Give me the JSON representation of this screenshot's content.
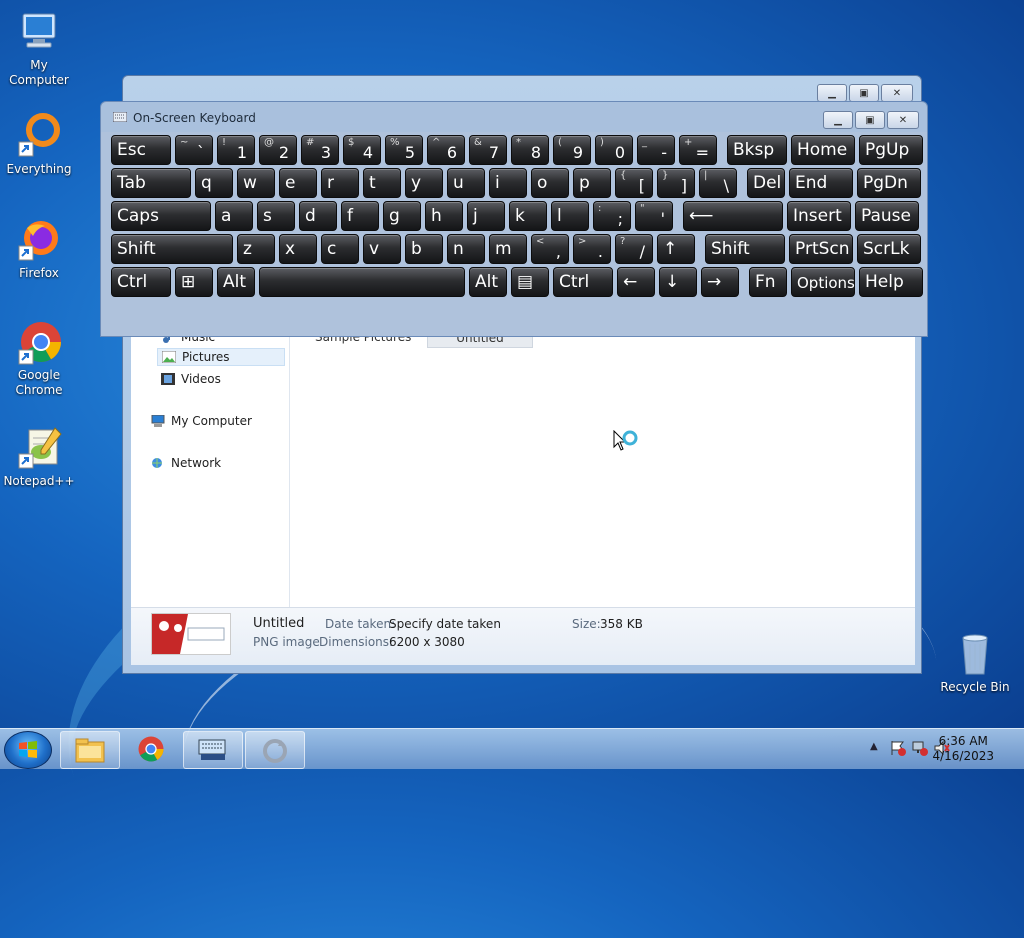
{
  "desktop": {
    "icons": [
      {
        "label": "My Computer"
      },
      {
        "label": "Everything"
      },
      {
        "label": "Firefox"
      },
      {
        "label": "Google Chrome"
      },
      {
        "label": "Notepad++"
      },
      {
        "label": "Recycle Bin"
      }
    ]
  },
  "explorer": {
    "nav": {
      "music": "Music",
      "pictures": "Pictures",
      "videos": "Videos",
      "my_computer": "My Computer",
      "network": "Network"
    },
    "columns": {
      "folder": "Sample Pictures",
      "file": "Untitled"
    },
    "details": {
      "name": "Untitled",
      "type": "PNG image",
      "date_label": "Date taken:",
      "date_value": "Specify date taken",
      "dim_label": "Dimensions:",
      "dim_value": "6200 x 3080",
      "size_label": "Size:",
      "size_value": "358 KB"
    }
  },
  "osk": {
    "title": "On-Screen Keyboard",
    "rows": [
      [
        {
          "m": "Esc",
          "w": 60
        },
        {
          "s": "~",
          "l": "`",
          "w": 38
        },
        {
          "s": "!",
          "l": "1",
          "w": 38
        },
        {
          "s": "@",
          "l": "2",
          "w": 38
        },
        {
          "s": "#",
          "l": "3",
          "w": 38
        },
        {
          "s": "$",
          "l": "4",
          "w": 38
        },
        {
          "s": "%",
          "l": "5",
          "w": 38
        },
        {
          "s": "^",
          "l": "6",
          "w": 38
        },
        {
          "s": "&",
          "l": "7",
          "w": 38
        },
        {
          "s": "*",
          "l": "8",
          "w": 38
        },
        {
          "s": "(",
          "l": "9",
          "w": 38
        },
        {
          "s": ")",
          "l": "0",
          "w": 38
        },
        {
          "s": "_",
          "l": "-",
          "w": 38
        },
        {
          "s": "+",
          "l": "=",
          "w": 38
        },
        {
          "m": "Bksp",
          "w": 60,
          "gap": 6
        },
        {
          "m": "Home",
          "w": 64
        },
        {
          "m": "PgUp",
          "w": 64
        }
      ],
      [
        {
          "m": "Tab",
          "w": 80
        },
        {
          "m": "q",
          "w": 38
        },
        {
          "m": "w",
          "w": 38
        },
        {
          "m": "e",
          "w": 38
        },
        {
          "m": "r",
          "w": 38
        },
        {
          "m": "t",
          "w": 38
        },
        {
          "m": "y",
          "w": 38
        },
        {
          "m": "u",
          "w": 38
        },
        {
          "m": "i",
          "w": 38
        },
        {
          "m": "o",
          "w": 38
        },
        {
          "m": "p",
          "w": 38
        },
        {
          "s": "{",
          "l": "[",
          "w": 38
        },
        {
          "s": "}",
          "l": "]",
          "w": 38
        },
        {
          "s": "|",
          "l": "\\",
          "w": 38
        },
        {
          "m": "Del",
          "w": 38,
          "gap": 6
        },
        {
          "m": "End",
          "w": 64
        },
        {
          "m": "PgDn",
          "w": 64
        }
      ],
      [
        {
          "m": "Caps",
          "w": 100
        },
        {
          "m": "a",
          "w": 38
        },
        {
          "m": "s",
          "w": 38
        },
        {
          "m": "d",
          "w": 38
        },
        {
          "m": "f",
          "w": 38
        },
        {
          "m": "g",
          "w": 38
        },
        {
          "m": "h",
          "w": 38
        },
        {
          "m": "j",
          "w": 38
        },
        {
          "m": "k",
          "w": 38
        },
        {
          "m": "l",
          "w": 38
        },
        {
          "s": ":",
          "l": ";",
          "w": 38
        },
        {
          "s": "\"",
          "l": "'",
          "w": 38
        },
        {
          "m": "⟵",
          "w": 100,
          "gap": 6
        },
        {
          "m": "Insert",
          "w": 64
        },
        {
          "m": "Pause",
          "w": 64
        }
      ],
      [
        {
          "m": "Shift",
          "w": 122
        },
        {
          "m": "z",
          "w": 38
        },
        {
          "m": "x",
          "w": 38
        },
        {
          "m": "c",
          "w": 38
        },
        {
          "m": "v",
          "w": 38
        },
        {
          "m": "b",
          "w": 38
        },
        {
          "m": "n",
          "w": 38
        },
        {
          "m": "m",
          "w": 38
        },
        {
          "s": "<",
          "l": ",",
          "w": 38
        },
        {
          "s": ">",
          "l": ".",
          "w": 38
        },
        {
          "s": "?",
          "l": "/",
          "w": 38
        },
        {
          "m": "↑",
          "w": 38
        },
        {
          "m": "Shift",
          "w": 80,
          "gap": 6
        },
        {
          "m": "PrtScn",
          "w": 64
        },
        {
          "m": "ScrLk",
          "w": 64
        }
      ],
      [
        {
          "m": "Ctrl",
          "w": 60
        },
        {
          "m": "⊞",
          "w": 38
        },
        {
          "m": "Alt",
          "w": 38
        },
        {
          "m": "",
          "w": 206
        },
        {
          "m": "Alt",
          "w": 38
        },
        {
          "m": "▤",
          "w": 38
        },
        {
          "m": "Ctrl",
          "w": 60
        },
        {
          "m": "←",
          "w": 38
        },
        {
          "m": "↓",
          "w": 38
        },
        {
          "m": "→",
          "w": 38
        },
        {
          "m": "Fn",
          "w": 38,
          "gap": 6
        },
        {
          "m": "Options",
          "w": 64,
          "small": true
        },
        {
          "m": "Help",
          "w": 64
        }
      ]
    ]
  },
  "taskbar": {
    "time": "6:36 AM",
    "date": "4/16/2023"
  }
}
